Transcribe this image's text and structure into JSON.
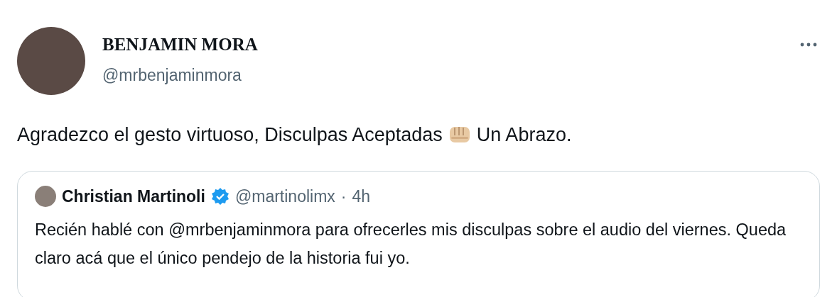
{
  "tweet": {
    "author": {
      "name": "BENJAMIN MORA",
      "handle": "@mrbenjaminmora"
    },
    "text_parts": [
      "Agradezco el gesto virtuoso, Disculpas Aceptadas",
      "Un Abrazo."
    ],
    "quote": {
      "author": {
        "name": "Christian Martinoli",
        "verified": true,
        "handle": "@martinolimx",
        "separator": "·",
        "time": "4h"
      },
      "text": "Recién hablé con @mrbenjaminmora para ofrecerles mis disculpas sobre el audio del viernes. Queda claro acá que el único pendejo de la historia fui yo."
    }
  }
}
